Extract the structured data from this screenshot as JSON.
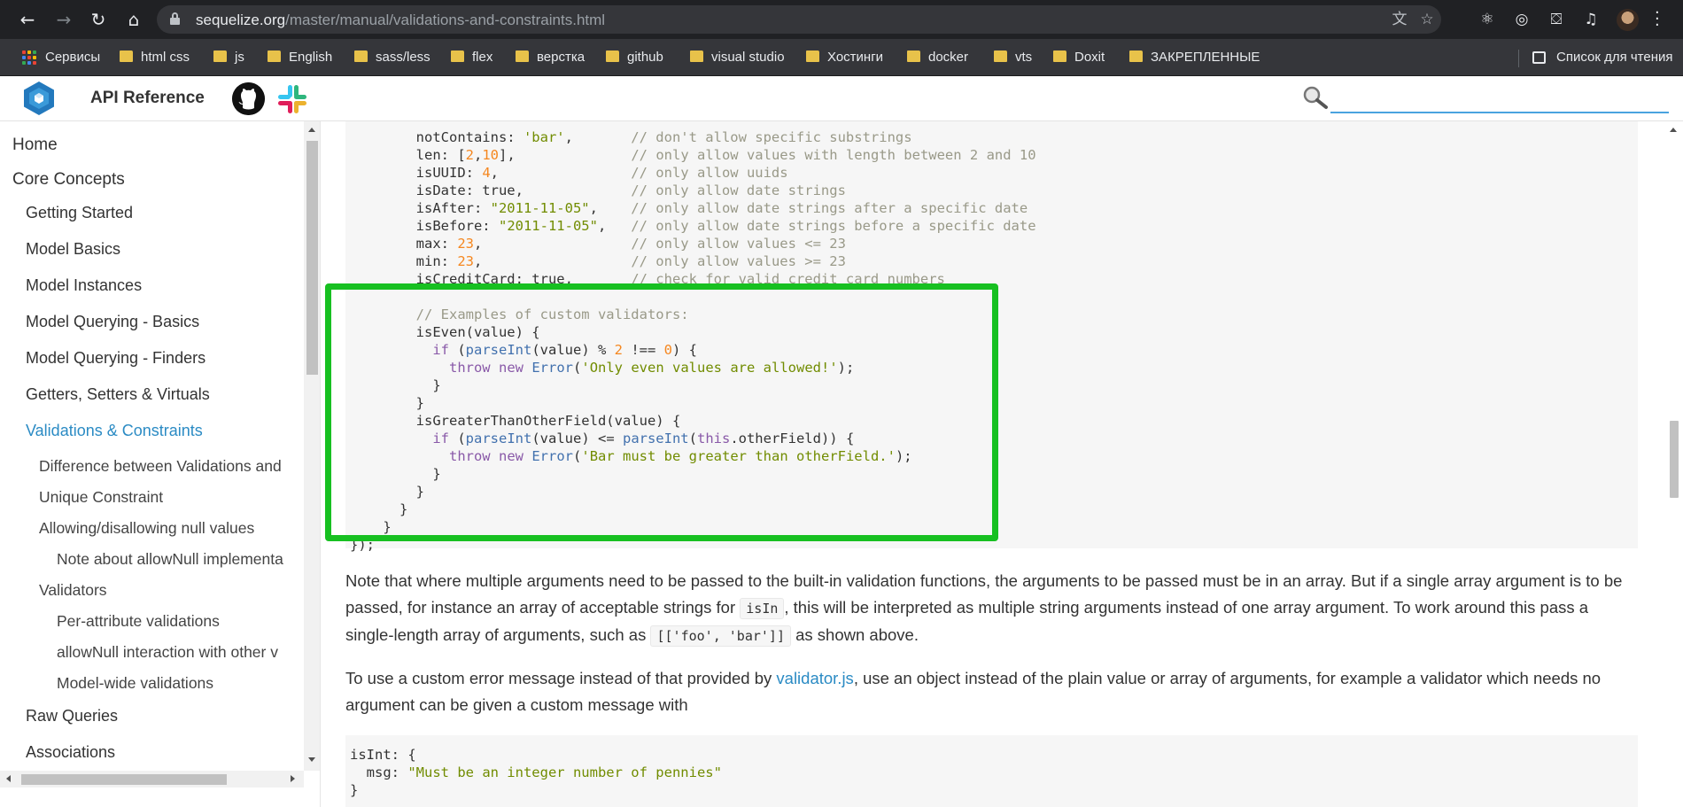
{
  "browser": {
    "url_host": "sequelize.org",
    "url_path": "/master/manual/validations-and-constraints.html",
    "bookmarks": [
      "Сервисы",
      "html css",
      "js",
      "English",
      "sass/less",
      "flex",
      "верстка",
      "github",
      "visual studio",
      "Хостинги",
      "docker",
      "vts",
      "Doxit",
      "ЗАКРЕПЛЕННЫЕ"
    ],
    "reading_list": "Список для чтения"
  },
  "header": {
    "api_reference": "API Reference",
    "search_value": ""
  },
  "sidebar": {
    "items": [
      {
        "label": "Home",
        "level": 0
      },
      {
        "label": "Core Concepts",
        "level": 0
      },
      {
        "label": "Getting Started",
        "level": 1
      },
      {
        "label": "Model Basics",
        "level": 1
      },
      {
        "label": "Model Instances",
        "level": 1
      },
      {
        "label": "Model Querying - Basics",
        "level": 1
      },
      {
        "label": "Model Querying - Finders",
        "level": 1
      },
      {
        "label": "Getters, Setters & Virtuals",
        "level": 1
      },
      {
        "label": "Validations & Constraints",
        "level": 1,
        "active": true
      },
      {
        "label": "Difference between Validations and",
        "level": 2
      },
      {
        "label": "Unique Constraint",
        "level": 2
      },
      {
        "label": "Allowing/disallowing null values",
        "level": 2
      },
      {
        "label": "Note about allowNull implementa",
        "level": 3
      },
      {
        "label": "Validators",
        "level": 2
      },
      {
        "label": "Per-attribute validations",
        "level": 3
      },
      {
        "label": "allowNull interaction with other v",
        "level": 3
      },
      {
        "label": "Model-wide validations",
        "level": 3
      },
      {
        "label": "Raw Queries",
        "level": 1
      },
      {
        "label": "Associations",
        "level": 1
      }
    ]
  },
  "content": {
    "code_lines": [
      "        notContains: 'bar',       // don't allow specific substrings",
      "        len: [2,10],              // only allow values with length between 2 and 10",
      "        isUUID: 4,                // only allow uuids",
      "        isDate: true,             // only allow date strings",
      "        isAfter: \"2011-11-05\",    // only allow date strings after a specific date",
      "        isBefore: \"2011-11-05\",   // only allow date strings before a specific date",
      "        max: 23,                  // only allow values <= 23",
      "        min: 23,                  // only allow values >= 23",
      "        isCreditCard: true,       // check for valid credit card numbers",
      "",
      "        // Examples of custom validators:",
      "        isEven(value) {",
      "          if (parseInt(value) % 2 !== 0) {",
      "            throw new Error('Only even values are allowed!');",
      "          }",
      "        }",
      "        isGreaterThanOtherField(value) {",
      "          if (parseInt(value) <= parseInt(this.otherField)) {",
      "            throw new Error('Bar must be greater than otherField.');",
      "          }",
      "        }",
      "      }",
      "    }",
      "});"
    ],
    "para1_a": "Note that where multiple arguments need to be passed to the built-in validation functions, the arguments to be passed must be in an array. But if a single array argument is to be passed, for instance an array of acceptable strings for ",
    "para1_code1": "isIn",
    "para1_b": ", this will be interpreted as multiple string arguments instead of one array argument. To work around this pass a single-length array of arguments, such as ",
    "para1_code2": "[['foo', 'bar']]",
    "para1_c": " as shown above.",
    "para2_a": "To use a custom error message instead of that provided by ",
    "para2_link": "validator.js",
    "para2_b": ", use an object instead of the plain value or array of arguments, for example a validator which needs no argument can be given a custom message with",
    "code2_lines": [
      "isInt: {",
      "  msg: \"Must be an integer number of pennies\"",
      "}"
    ]
  },
  "colors": {
    "accent": "#2b8bc4",
    "highlight_border": "#17c021",
    "browser_bg": "#202124"
  }
}
